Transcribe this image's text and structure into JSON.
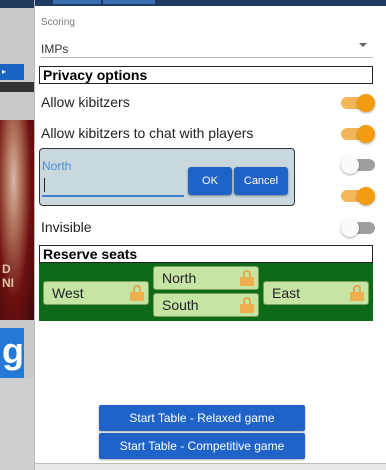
{
  "background": {
    "ad_button": "→ ▸",
    "ad_text": "D\nNI",
    "ad_letter": "g"
  },
  "scoring": {
    "label": "Scoring",
    "value": "IMPs"
  },
  "privacy": {
    "header": "Privacy options",
    "allow_kibitzers": {
      "label": "Allow kibitzers",
      "state": "on"
    },
    "allow_chat": {
      "label": "Allow kibitzers to chat with players",
      "state": "on"
    },
    "hidden_option": {
      "state": "on"
    },
    "invisible": {
      "label": "Invisible",
      "state": "off"
    }
  },
  "edit_popup": {
    "field_label": "North",
    "field_value": "",
    "ok_label": "OK",
    "cancel_label": "Cancel"
  },
  "reserve": {
    "header": "Reserve seats",
    "seats": [
      {
        "name": "West",
        "icon": "lock-icon"
      },
      {
        "name": "North",
        "icon": "lock-icon"
      },
      {
        "name": "South",
        "icon": "lock-icon"
      },
      {
        "name": "East",
        "icon": "lock-icon"
      }
    ]
  },
  "buttons": {
    "start_relaxed": "Start Table - Relaxed game",
    "start_competitive": "Start Table - Competitive game"
  },
  "colors": {
    "accent_blue": "#1f63c9",
    "toggle_on": "#f39c12",
    "reserve_bg": "#0d6a18",
    "seat_bg": "#c6e4a4"
  }
}
